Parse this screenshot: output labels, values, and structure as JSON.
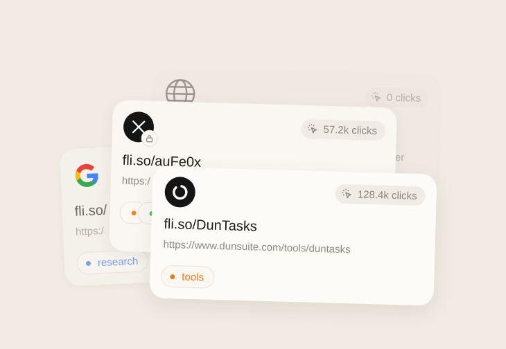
{
  "cards": {
    "globe": {
      "clicks": "0 clicks",
      "partial_text": "er"
    },
    "google": {
      "short_url": "fli.so/",
      "long_url": "https:/",
      "tag": {
        "label": "research",
        "color": "#7aa3e6"
      }
    },
    "x": {
      "clicks": "57.2k clicks",
      "short_url": "fli.so/auFe0x",
      "long_url": "https:/",
      "tag_dots": [
        "#f08a24",
        "#4cbf5a"
      ]
    },
    "front": {
      "clicks": "128.4k clicks",
      "short_url": "fli.so/DunTasks",
      "long_url": "https://www.dunsuite.com/tools/duntasks",
      "tag": {
        "label": "tools",
        "color": "#f07a1a"
      }
    }
  },
  "colors": {
    "background": "#f1ebe3",
    "tools_tag": "#f07a1a",
    "research_tag": "#7aa3e6"
  }
}
